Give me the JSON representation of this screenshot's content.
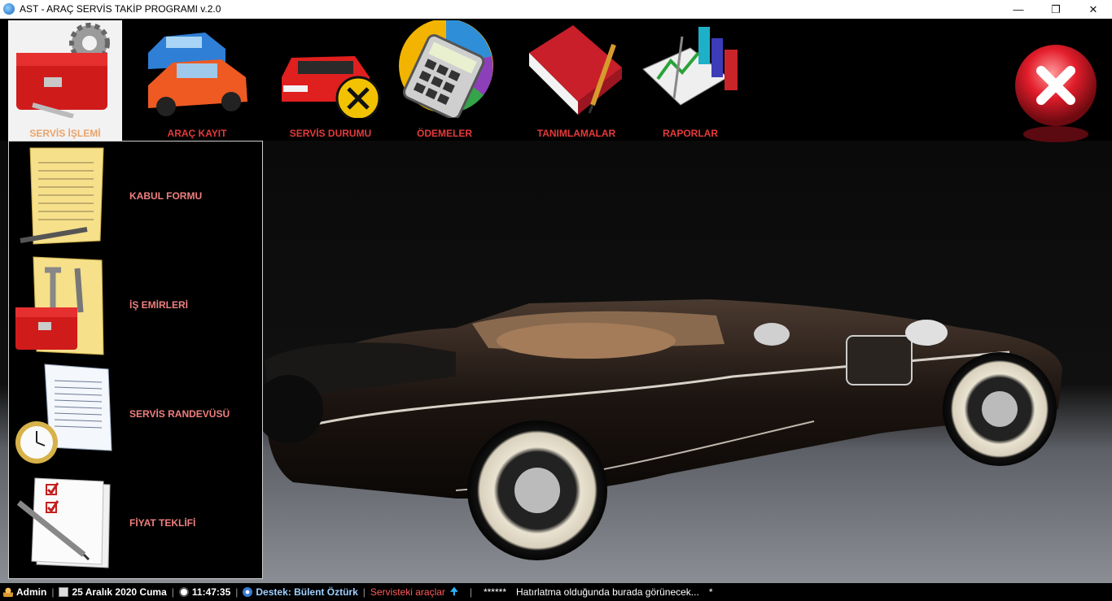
{
  "window": {
    "title": "AST - ARAÇ SERVİS TAKİP PROGRAMI v.2.0",
    "minimize_glyph": "—",
    "maximize_glyph": "❐",
    "close_glyph": "✕"
  },
  "toolbar": {
    "items": [
      {
        "label": "SERVİS İŞLEMİ",
        "icon": "toolbox-gear-icon",
        "active": true
      },
      {
        "label": "ARAÇ KAYIT",
        "icon": "cars-icon"
      },
      {
        "label": "SERVİS DURUMU",
        "icon": "car-repair-icon"
      },
      {
        "label": "ÖDEMELER",
        "icon": "calculator-chart-icon"
      },
      {
        "label": "TANIMLAMALAR",
        "icon": "notebook-pen-icon"
      },
      {
        "label": "RAPORLAR",
        "icon": "report-chart-icon"
      }
    ],
    "exit_icon": "exit-close-icon"
  },
  "menu": {
    "items": [
      {
        "label": "KABUL FORMU",
        "icon": "document-pen-icon"
      },
      {
        "label": "İŞ EMİRLERİ",
        "icon": "work-order-tools-icon"
      },
      {
        "label": "SERVİS RANDEVÜSÜ",
        "icon": "appointment-clock-icon"
      },
      {
        "label": "FİYAT TEKLİFİ",
        "icon": "checklist-pen-icon"
      }
    ]
  },
  "status": {
    "user": "Admin",
    "date": "25 Aralık 2020 Cuma",
    "time": "11:47:35",
    "support": "Destek: Bülent Öztürk",
    "in_service": "Servisteki araçlar",
    "stars": "******",
    "reminder": "Hatırlatma olduğunda burada görünecek...",
    "trail": "*"
  },
  "colors": {
    "label_red": "#e63a3a",
    "active_label": "#e9a46b",
    "menu_label": "#f07f7f"
  }
}
